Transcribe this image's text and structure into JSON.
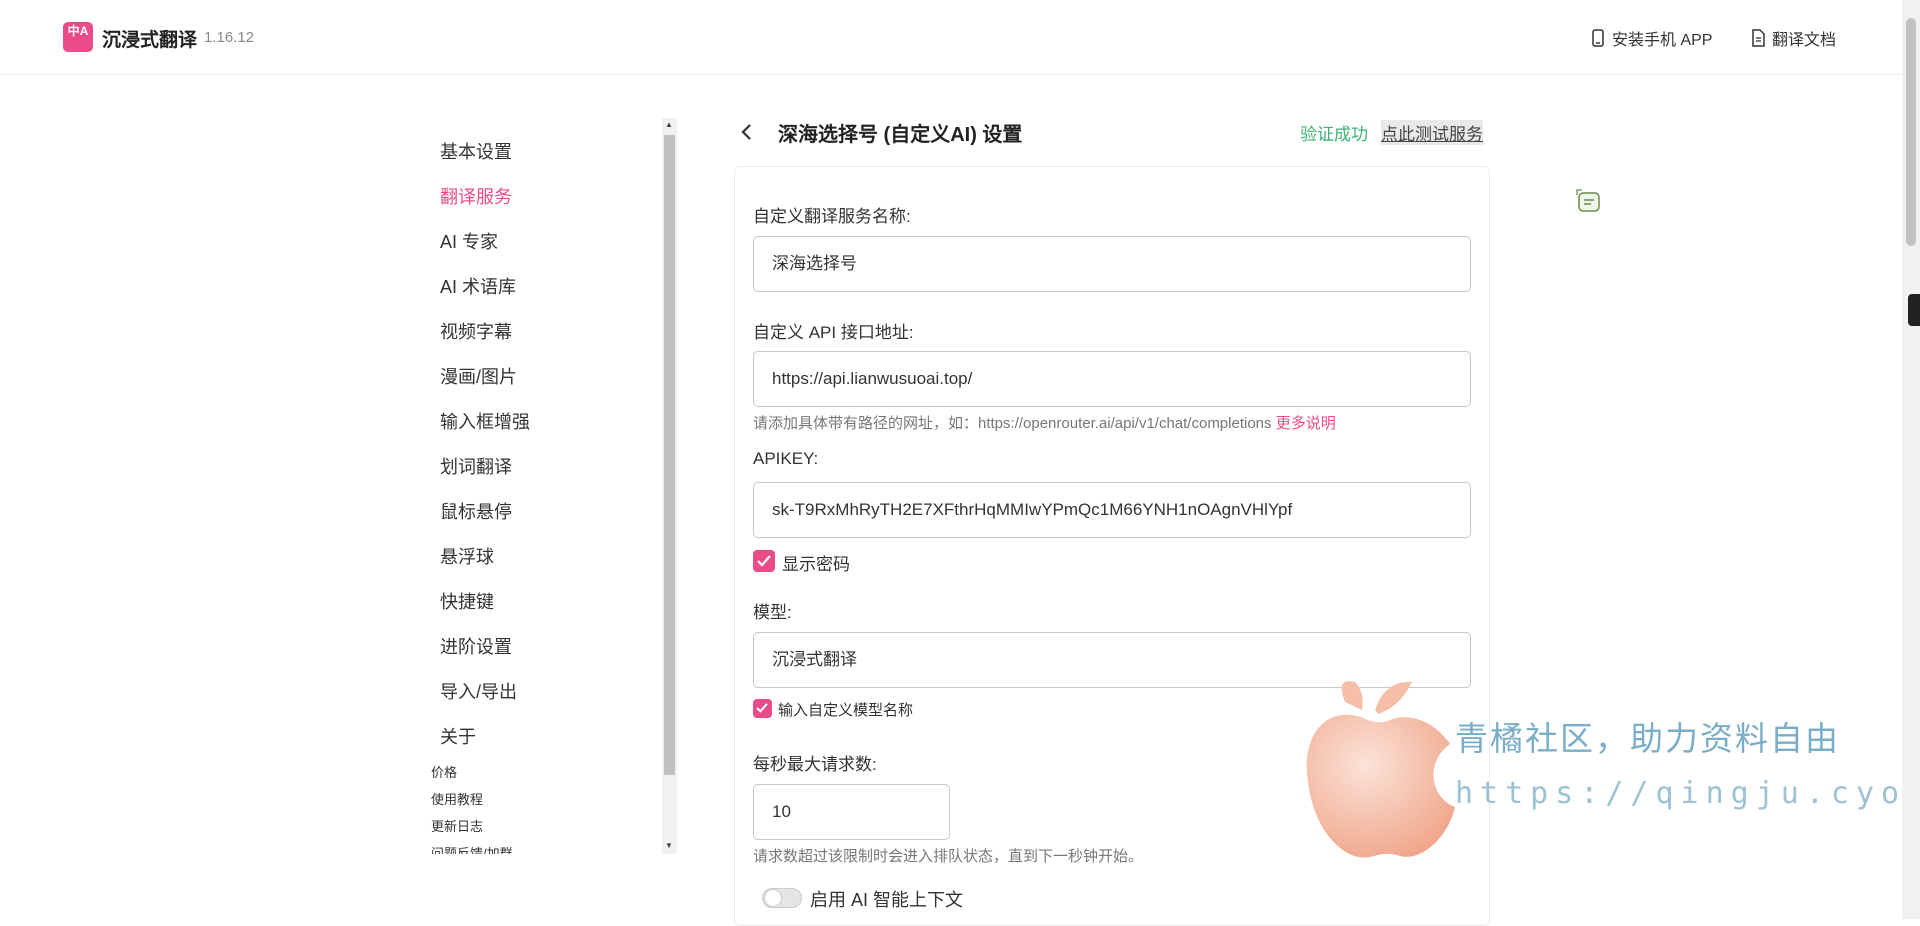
{
  "header": {
    "logo_text": "中A",
    "app_name": "沉浸式翻译",
    "version": "1.16.12",
    "install_app_label": "安装手机 APP",
    "docs_label": "翻译文档"
  },
  "sidebar": {
    "items": [
      {
        "label": "基本设置"
      },
      {
        "label": "翻译服务",
        "active": true
      },
      {
        "label": "AI 专家"
      },
      {
        "label": "AI 术语库"
      },
      {
        "label": "视频字幕"
      },
      {
        "label": "漫画/图片"
      },
      {
        "label": "输入框增强"
      },
      {
        "label": "划词翻译"
      },
      {
        "label": "鼠标悬停"
      },
      {
        "label": "悬浮球"
      },
      {
        "label": "快捷键"
      },
      {
        "label": "进阶设置"
      },
      {
        "label": "导入/导出"
      },
      {
        "label": "关于"
      }
    ],
    "small_links": [
      "价格",
      "使用教程",
      "更新日志",
      "问题反馈/加群"
    ]
  },
  "main": {
    "title": "深海选择号 (自定义AI) 设置",
    "verify_status": "验证成功",
    "test_link": "点此测试服务",
    "fields": {
      "service_name_label": "自定义翻译服务名称:",
      "service_name_value": "深海选择号",
      "api_url_label": "自定义 API 接口地址:",
      "api_url_value": "https://api.lianwusuoai.top/",
      "api_url_hint": "请添加具体带有路径的网址，如：https://openrouter.ai/api/v1/chat/completions",
      "api_url_more": "更多说明",
      "apikey_label": "APIKEY:",
      "apikey_value": "sk-T9RxMhRyTH2E7XFthrHqMMIwYPmQc1M66YNH1nOAgnVHlYpf",
      "show_password_label": "显示密码",
      "show_password_checked": true,
      "model_label": "模型:",
      "model_value": "沉浸式翻译",
      "custom_model_label": "输入自定义模型名称",
      "custom_model_checked": true,
      "max_rps_label": "每秒最大请求数:",
      "max_rps_value": "10",
      "max_rps_hint": "请求数超过该限制时会进入排队状态，直到下一秒钟开始。",
      "ai_context_label": "启用 AI 智能上下文",
      "ai_context_enabled": false
    }
  },
  "watermark": {
    "line1": "青橘社区，助力资料自由",
    "line2": "https://qingju.cyou"
  },
  "colors": {
    "accent": "#ea4c89",
    "success": "#3cb371"
  }
}
